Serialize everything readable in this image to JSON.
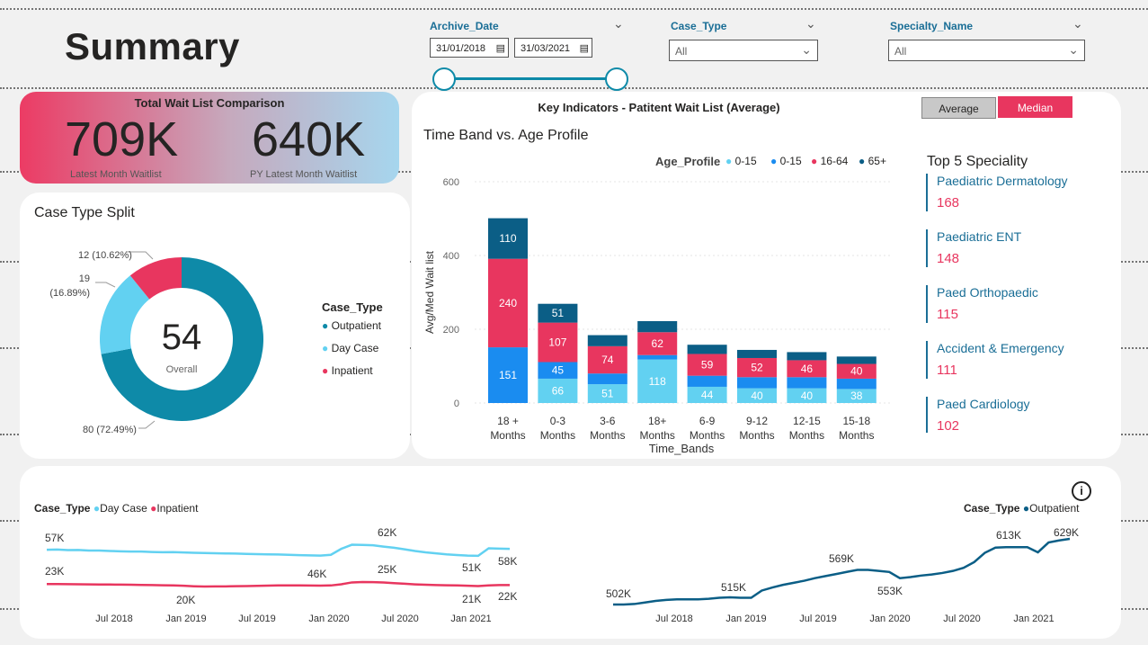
{
  "page_title": "Summary",
  "filters": {
    "archive_date": {
      "label": "Archive_Date",
      "start": "31/01/2018",
      "end": "31/03/2021"
    },
    "case_type": {
      "label": "Case_Type",
      "value": "All"
    },
    "specialty": {
      "label": "Specialty_Name",
      "value": "All"
    }
  },
  "kpi": {
    "title": "Total Wait List Comparison",
    "latest_value": "709K",
    "latest_label": "Latest Month Waitlist",
    "py_value": "640K",
    "py_label": "PY Latest Month Waitlist"
  },
  "toggle": {
    "average": "Average",
    "median": "Median"
  },
  "colors": {
    "teal": "#0e8aa8",
    "light_blue": "#62d1f1",
    "blue": "#1a8cf0",
    "pink": "#e8365f",
    "dark_blue": "#0b5e86"
  },
  "case_split": {
    "title": "Case Type Split",
    "center_value": "54",
    "center_label": "Overall",
    "legend_title": "Case_Type",
    "legend": [
      "Outpatient",
      "Day Case",
      "Inpatient"
    ],
    "labels": {
      "outpatient": "80 (72.49%)",
      "daycase_a": "19",
      "daycase_b": "(16.89%)",
      "inpatient": "12 (10.62%)"
    }
  },
  "key_indicators": {
    "title": "Key Indicators - Patitent Wait List (Average)",
    "subtitle": "Time Band vs. Age Profile",
    "legend_title": "Age_Profile",
    "legend": [
      "0-15",
      "0-15",
      "16-64",
      "65+"
    ]
  },
  "top5": {
    "title": "Top 5 Speciality",
    "items": [
      {
        "name": "Paediatric Dermatology",
        "value": "168"
      },
      {
        "name": "Paediatric ENT",
        "value": "148"
      },
      {
        "name": "Paed Orthopaedic",
        "value": "115"
      },
      {
        "name": "Accident & Emergency",
        "value": "111"
      },
      {
        "name": "Paed Cardiology",
        "value": "102"
      }
    ]
  },
  "bottom_left_legend": {
    "title": "Case_Type",
    "items": [
      "Day Case",
      "Inpatient"
    ]
  },
  "bottom_right_legend": {
    "title": "Case_Type",
    "items": [
      "Outpatient"
    ]
  },
  "chart_data": [
    {
      "type": "bar",
      "stacked": true,
      "xlabel": "Time_Bands",
      "ylabel": "Avg/Med Wait list",
      "ylim": [
        0,
        600
      ],
      "yticks": [
        0,
        200,
        400,
        600
      ],
      "categories": [
        [
          "18 +",
          "Months"
        ],
        [
          "0-3",
          "Months"
        ],
        [
          "3-6",
          "Months"
        ],
        [
          "18+",
          "Months"
        ],
        [
          "6-9",
          "Months"
        ],
        [
          "9-12",
          "Months"
        ],
        [
          "12-15",
          "Months"
        ],
        [
          "15-18",
          "Months"
        ]
      ],
      "series": [
        {
          "name": "0-15",
          "color": "#62d1f1",
          "values": [
            0,
            66,
            51,
            118,
            44,
            40,
            40,
            38
          ],
          "labels": [
            "",
            "66",
            "51",
            "118",
            "44",
            "40",
            "40",
            "38"
          ]
        },
        {
          "name": "0-15",
          "color": "#1a8cf0",
          "values": [
            151,
            45,
            29,
            12,
            30,
            30,
            30,
            28
          ],
          "labels": [
            "151",
            "45",
            "",
            "",
            "",
            "",
            "",
            ""
          ]
        },
        {
          "name": "16-64",
          "color": "#e8365f",
          "values": [
            240,
            107,
            74,
            62,
            59,
            52,
            46,
            40
          ],
          "labels": [
            "240",
            "107",
            "74",
            "62",
            "59",
            "52",
            "46",
            "40"
          ]
        },
        {
          "name": "65+",
          "color": "#0b5e86",
          "values": [
            110,
            51,
            30,
            30,
            25,
            22,
            22,
            20
          ],
          "labels": [
            "110",
            "51",
            "",
            "",
            "",
            "",
            "",
            ""
          ]
        }
      ]
    },
    {
      "type": "pie",
      "donut": true,
      "slices": [
        {
          "name": "Outpatient",
          "value": 80,
          "pct": 72.49,
          "color": "#0e8aa8"
        },
        {
          "name": "Day Case",
          "value": 19,
          "pct": 16.89,
          "color": "#62d1f1"
        },
        {
          "name": "Inpatient",
          "value": 12,
          "pct": 10.62,
          "color": "#e8365f"
        }
      ]
    },
    {
      "type": "line",
      "x_ticks": [
        "Jul 2018",
        "Jan 2019",
        "Jul 2019",
        "Jan 2020",
        "Jul 2020",
        "Jan 2021"
      ],
      "ylim": [
        0,
        70000
      ],
      "series": [
        {
          "name": "Day Case",
          "color": "#62d1f1",
          "values": [
            57000,
            57200,
            56700,
            56800,
            56200,
            56300,
            55800,
            55500,
            55300,
            55200,
            54800,
            54600,
            54700,
            54400,
            54000,
            53800,
            53600,
            53400,
            53200,
            52900,
            52700,
            52500,
            52300,
            52000,
            51700,
            51400,
            51200,
            52000,
            58000,
            62000,
            61800,
            61500,
            60200,
            59000,
            57500,
            55800,
            54500,
            53500,
            52500,
            51800,
            51200,
            51000,
            58500,
            58200,
            57900
          ]
        },
        {
          "name": "Inpatient",
          "color": "#e8365f",
          "values": [
            23000,
            23000,
            22900,
            22800,
            22700,
            22600,
            22500,
            22400,
            22300,
            22100,
            22000,
            21800,
            21600,
            21300,
            20800,
            20500,
            20600,
            20700,
            20900,
            21000,
            21200,
            21400,
            21600,
            21700,
            21600,
            21500,
            21400,
            21600,
            22800,
            24600,
            25000,
            24900,
            24500,
            23900,
            23300,
            22700,
            22300,
            22000,
            21800,
            21600,
            21300,
            21000,
            21700,
            22000,
            22000
          ]
        }
      ],
      "labels": [
        "57K",
        "23K",
        "20K",
        "46K",
        "62K",
        "25K",
        "51K",
        "21K",
        "58K",
        "22K"
      ]
    },
    {
      "type": "line",
      "x_ticks": [
        "Jul 2018",
        "Jan 2019",
        "Jul 2019",
        "Jan 2020",
        "Jul 2020",
        "Jan 2021"
      ],
      "ylim": [
        480000,
        650000
      ],
      "series": [
        {
          "name": "Outpatient",
          "color": "#0b5e86",
          "values": [
            502000,
            502000,
            503000,
            506000,
            509000,
            511000,
            512000,
            512000,
            512000,
            513000,
            515000,
            516000,
            515000,
            515000,
            529000,
            535000,
            540000,
            544000,
            548000,
            553000,
            557000,
            561000,
            565000,
            569000,
            569000,
            567000,
            565000,
            553000,
            555000,
            558000,
            560000,
            563000,
            567000,
            573000,
            584000,
            602000,
            612000,
            613000,
            613000,
            613000,
            603000,
            622000,
            626000,
            629000
          ]
        }
      ],
      "labels": [
        "502K",
        "515K",
        "569K",
        "553K",
        "613K",
        "629K"
      ]
    }
  ]
}
